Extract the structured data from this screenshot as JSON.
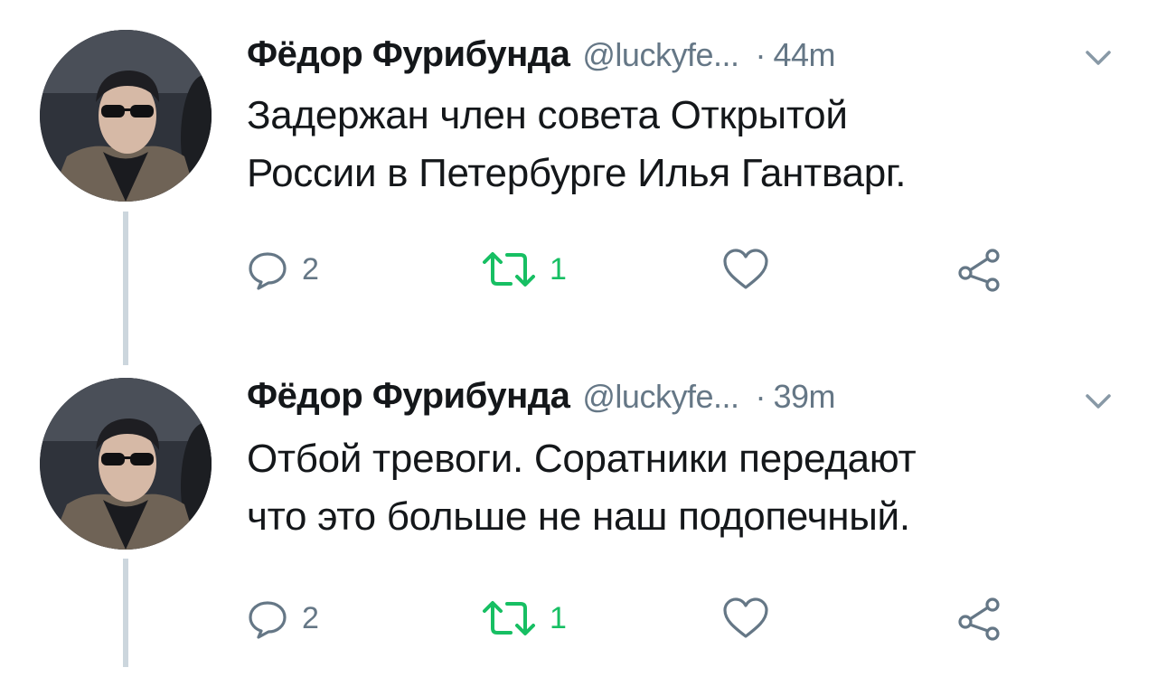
{
  "tweets": [
    {
      "display_name": "Фёдор Фурибунда",
      "handle": "@luckyfe...",
      "separator": "·",
      "time": "44m",
      "text_lines": [
        "Задержан член совета Открытой",
        "России в Петербурге Илья Гантварг."
      ],
      "reply_count": "2",
      "retweet_count": "1",
      "retweeted": true,
      "liked": false
    },
    {
      "display_name": "Фёдор Фурибунда",
      "handle": "@luckyfe...",
      "separator": "·",
      "time": "39m",
      "text_lines": [
        "Отбой тревоги. Соратники передают",
        "что это больше не наш подопечный."
      ],
      "reply_count": "2",
      "retweet_count": "1",
      "retweeted": true,
      "liked": false
    }
  ],
  "colors": {
    "text_primary": "#14171a",
    "text_secondary": "#657786",
    "retweet_active": "#17bf63",
    "thread_line": "#ccd6dd"
  },
  "icons": {
    "reply": "reply-icon",
    "retweet": "retweet-icon",
    "like": "heart-icon",
    "share": "share-icon",
    "menu": "chevron-down-icon"
  }
}
